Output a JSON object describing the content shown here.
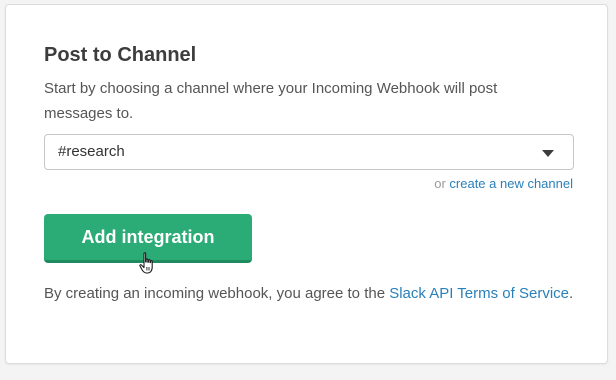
{
  "section": {
    "title": "Post to Channel",
    "description": "Start by choosing a channel where your Incoming Webhook will post messages to."
  },
  "channel_select": {
    "selected": "#research",
    "icon": "caret-down-icon"
  },
  "create_channel": {
    "prefix": "or",
    "link_label": "create a new channel"
  },
  "add_button": {
    "label": "Add integration"
  },
  "cursor": {
    "icon": "hand-pointer-icon"
  },
  "terms": {
    "prefix": "By creating an incoming webhook, you agree to the",
    "link_label": "Slack API Terms of Service",
    "suffix": "."
  },
  "colors": {
    "accent_green": "#2bac76",
    "link_blue": "#2a80b9"
  }
}
